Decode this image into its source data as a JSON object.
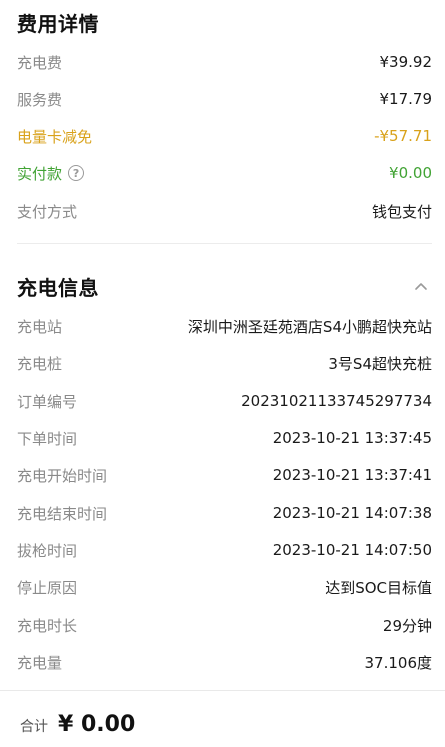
{
  "fees": {
    "title": "费用详情",
    "rows": [
      {
        "label": "充电费",
        "value": "¥39.92"
      },
      {
        "label": "服务费",
        "value": "¥17.79"
      },
      {
        "label": "电量卡减免",
        "value": "-¥57.71"
      },
      {
        "label": "实付款",
        "value": "¥0.00"
      },
      {
        "label": "支付方式",
        "value": "钱包支付"
      }
    ],
    "help_icon": "question-circle-icon",
    "colors": {
      "discount": "#d9a21b",
      "paid": "#41a334"
    }
  },
  "charging": {
    "title": "充电信息",
    "collapse_icon": "chevron-up-icon",
    "rows": [
      {
        "label": "充电站",
        "value": "深圳中洲圣廷苑酒店S4小鹏超快充站"
      },
      {
        "label": "充电桩",
        "value": "3号S4超快充桩"
      },
      {
        "label": "订单编号",
        "value": "20231021133745297734"
      },
      {
        "label": "下单时间",
        "value": "2023-10-21 13:37:45"
      },
      {
        "label": "充电开始时间",
        "value": "2023-10-21 13:37:41"
      },
      {
        "label": "充电结束时间",
        "value": "2023-10-21 14:07:38"
      },
      {
        "label": "拔枪时间",
        "value": "2023-10-21 14:07:50"
      },
      {
        "label": "停止原因",
        "value": "达到SOC目标值"
      },
      {
        "label": "充电时长",
        "value": "29分钟"
      },
      {
        "label": "充电量",
        "value": "37.106度"
      }
    ]
  },
  "footer": {
    "total_label": "合计",
    "total_value": "¥ 0.00"
  }
}
